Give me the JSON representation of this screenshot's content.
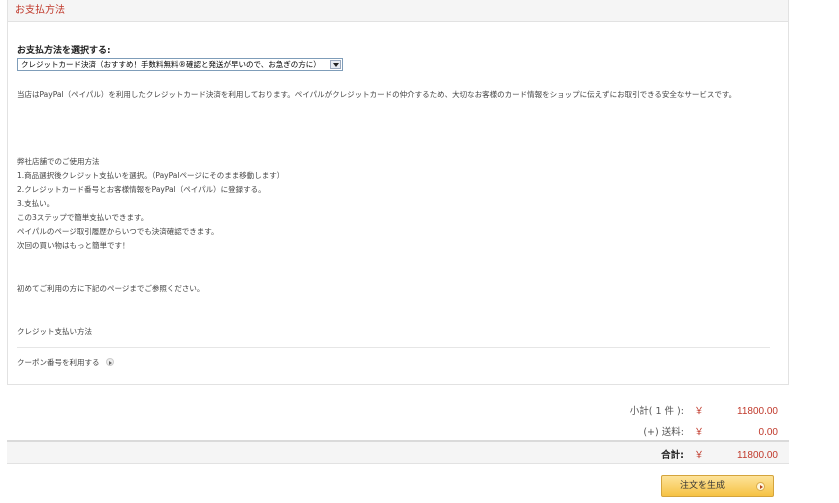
{
  "panel": {
    "title": "お支払方法",
    "select_heading": "お支払方法を選択する:",
    "selected_method": "クレジットカード決済（おすすめ！手数料無料®確認と発送が早いので、お急ぎの方に）",
    "intro": "当店はPayPal（ペイパル）を利用したクレジットカード決済を利用しております。ペイパルがクレジットカードの仲介するため、大切なお客様のカード情報をショップに伝えずにお取引できる安全なサービスです。",
    "usage_title": "弊社店舗でのご使用方法",
    "steps": [
      "1.商品選択後クレジット支払いを選択。（PayPalページにそのまま移動します）",
      "2.クレジットカード番号とお客様情報をPayPal（ペイパル）に登録する。",
      "3.支払い。"
    ],
    "notes": [
      "この3ステップで簡単支払いできます。",
      "ペイパルのページ取引履歴からいつでも決済確認できます。",
      "次回の買い物はもっと簡単です！"
    ],
    "first_time": "初めてご利用の方に下記のページまでご参照ください。",
    "credit_link": "クレジット支払い方法",
    "coupon_label": "クーポン番号を利用する"
  },
  "summary": {
    "subtotal_label": "小計( 1 件 ):",
    "subtotal_value": "11800.00",
    "shipping_label": "(+) 送料:",
    "shipping_value": "0.00",
    "total_label": "合計:",
    "total_value": "11800.00",
    "currency": "￥"
  },
  "actions": {
    "order_button": "注文を生成"
  },
  "icons": {
    "coupon": "arrow-right-circle-icon",
    "order_button": "arrow-right-circle-icon",
    "select": "dropdown-arrow-icon"
  },
  "colors": {
    "accent_red": "#c0392b",
    "button_gold": "#f6c244"
  }
}
